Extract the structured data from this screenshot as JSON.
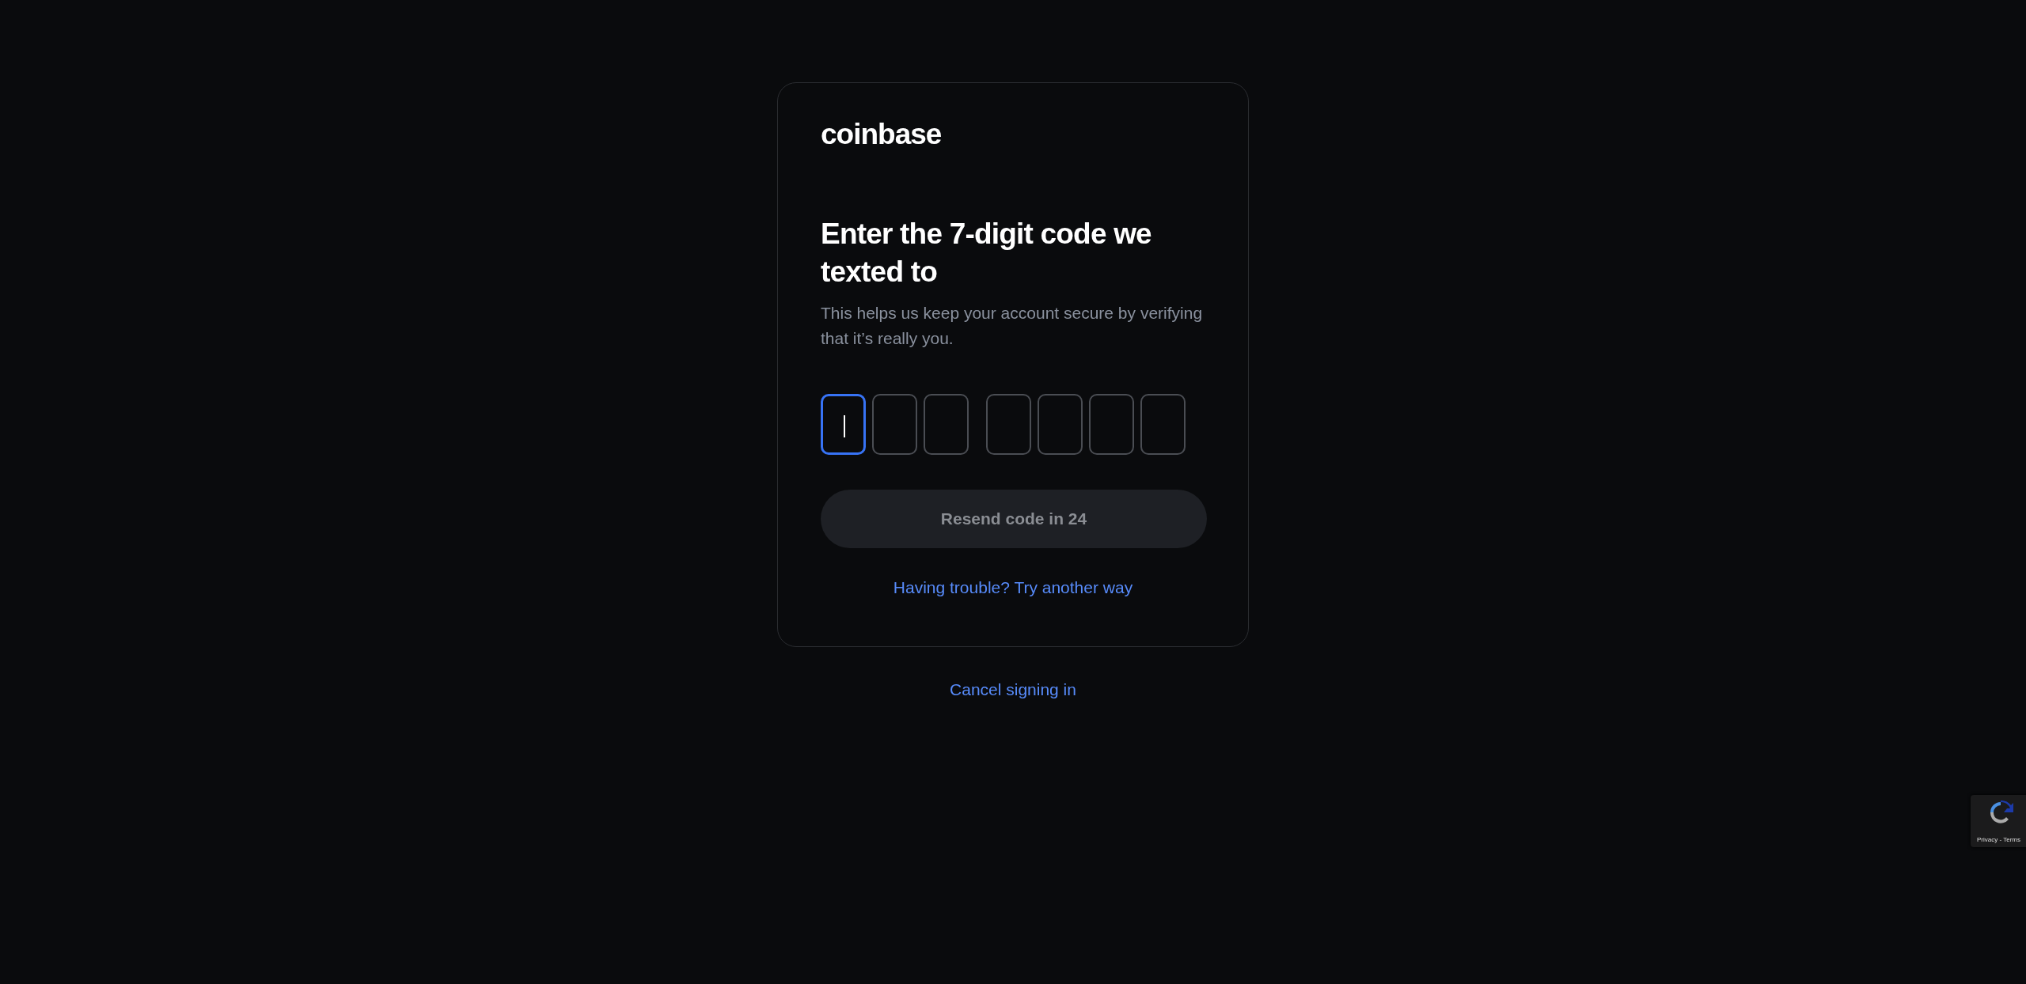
{
  "logo": {
    "text": "coinbase"
  },
  "heading": "Enter the 7-digit code we texted to",
  "subtitle": "This helps us keep your account secure by verifying that it’s really you.",
  "code_groups": [
    {
      "boxes": [
        {
          "focused": true
        },
        {
          "focused": false
        },
        {
          "focused": false
        }
      ]
    },
    {
      "boxes": [
        {
          "focused": false
        },
        {
          "focused": false
        },
        {
          "focused": false
        },
        {
          "focused": false
        }
      ]
    }
  ],
  "resend_button": {
    "label": "Resend code in 24",
    "disabled": true
  },
  "help_link": "Having trouble? Try another way",
  "cancel_link": "Cancel signing in",
  "recaptcha_badge": {
    "text": "Privacy - Terms"
  }
}
